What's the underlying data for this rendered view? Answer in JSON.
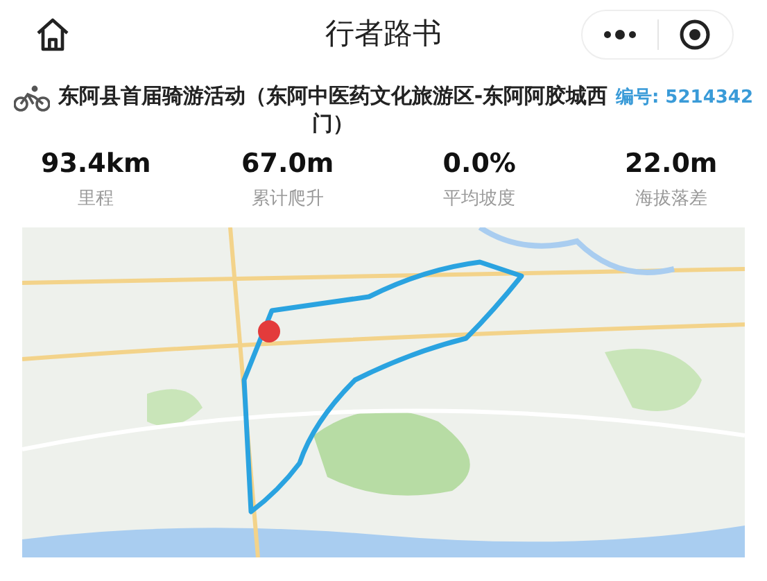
{
  "header": {
    "title": "行者路书"
  },
  "route": {
    "name": "东阿县首届骑游活动（东阿中医药文化旅游区-东阿阿胶城西门）",
    "code": "编号: 5214342"
  },
  "stats": [
    {
      "value": "93.4km",
      "label": "里程"
    },
    {
      "value": "67.0m",
      "label": "累计爬升"
    },
    {
      "value": "0.0%",
      "label": "平均坡度"
    },
    {
      "value": "22.0m",
      "label": "海拔落差"
    }
  ]
}
